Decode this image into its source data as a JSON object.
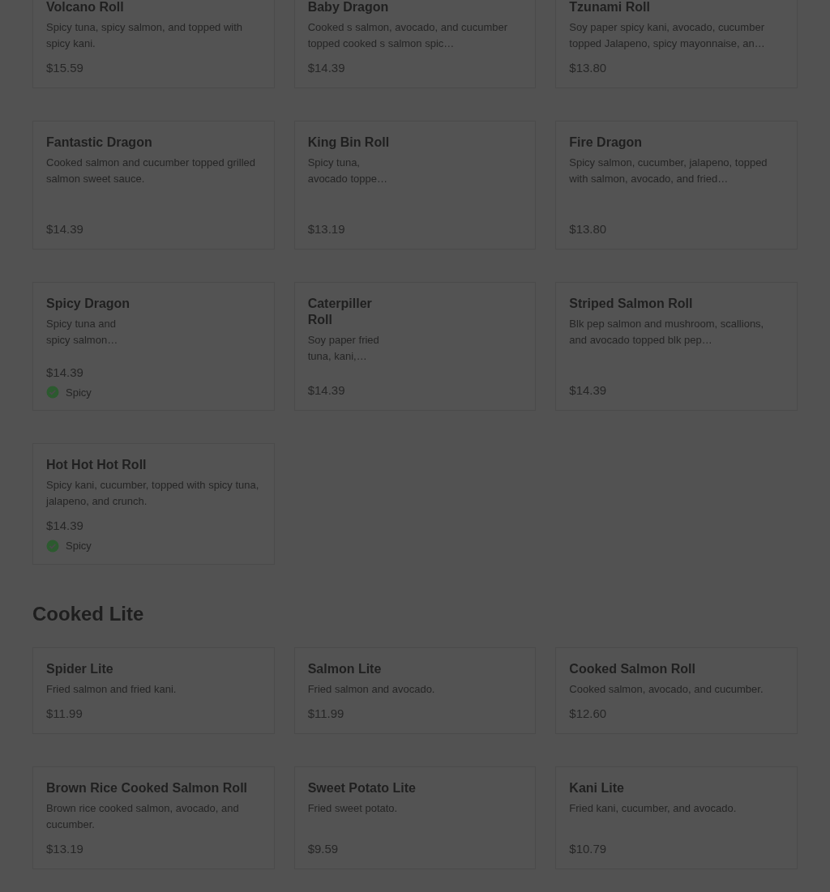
{
  "sections": [
    {
      "items": [
        {
          "name": "Volcano Roll",
          "description": "Spicy tuna, spicy salmon, and topped with spicy kani.",
          "price": "$15.59",
          "kind": "wide"
        },
        {
          "name": "Baby Dragon",
          "description": "Cooked s salmon, avocado, and cucumber topped cooked s salmon spic…",
          "price": "$14.39",
          "kind": "wide"
        },
        {
          "name": "Tzunami Roll",
          "description": "Soy paper spicy kani, avocado, cucumber topped Jalapeno, spicy mayonnaise, an…",
          "price": "$13.80",
          "kind": "wide"
        },
        {
          "name": "Fantastic Dragon",
          "description": "Cooked salmon and cucumber topped grilled salmon sweet sauce.",
          "price": "$14.39",
          "kind": "wide"
        },
        {
          "name": "King Bin Roll",
          "description": "Spicy tuna, avocado toppe…",
          "price": "$13.19",
          "kind": "narrow"
        },
        {
          "name": "Fire Dragon",
          "description": "Spicy salmon, cucumber, jalapeno, topped with salmon, avocado, and fried…",
          "price": "$13.80",
          "kind": "wide"
        },
        {
          "name": "Spicy Dragon",
          "description": "Spicy tuna and spicy salmon…",
          "price": "$14.39",
          "kind": "narrow",
          "tag": "Spicy"
        },
        {
          "name": "Caterpiller Roll",
          "description": "Soy paper fried tuna, kani,…",
          "price": "$14.39",
          "kind": "narrow"
        },
        {
          "name": "Striped Salmon Roll",
          "description": "Blk pep salmon and mushroom, scallions, and avocado topped blk pep…",
          "price": "$14.39",
          "kind": "wide"
        },
        {
          "name": "Hot Hot Hot Roll",
          "description": "Spicy kani, cucumber, topped with spicy tuna, jalapeno, and crunch.",
          "price": "$14.39",
          "kind": "wide",
          "tag": "Spicy"
        }
      ]
    },
    {
      "title": "Cooked Lite",
      "items": [
        {
          "name": "Spider Lite",
          "description": "Fried salmon and fried kani.",
          "price": "$11.99",
          "kind": "wide"
        },
        {
          "name": "Salmon Lite",
          "description": "Fried salmon and avocado.",
          "price": "$11.99",
          "kind": "wide"
        },
        {
          "name": "Cooked Salmon Roll",
          "description": "Cooked salmon, avocado, and cucumber.",
          "price": "$12.60",
          "kind": "wide"
        },
        {
          "name": "Brown Rice Cooked Salmon Roll",
          "description": "Brown rice cooked salmon, avocado, and cucumber.",
          "price": "$13.19",
          "kind": "wide"
        },
        {
          "name": "Sweet Potato Lite",
          "description": "Fried sweet potato.",
          "price": "$9.59",
          "kind": "wide"
        },
        {
          "name": "Kani Lite",
          "description": "Fried kani, cucumber, and avocado.",
          "price": "$10.79",
          "kind": "wide"
        }
      ]
    }
  ]
}
